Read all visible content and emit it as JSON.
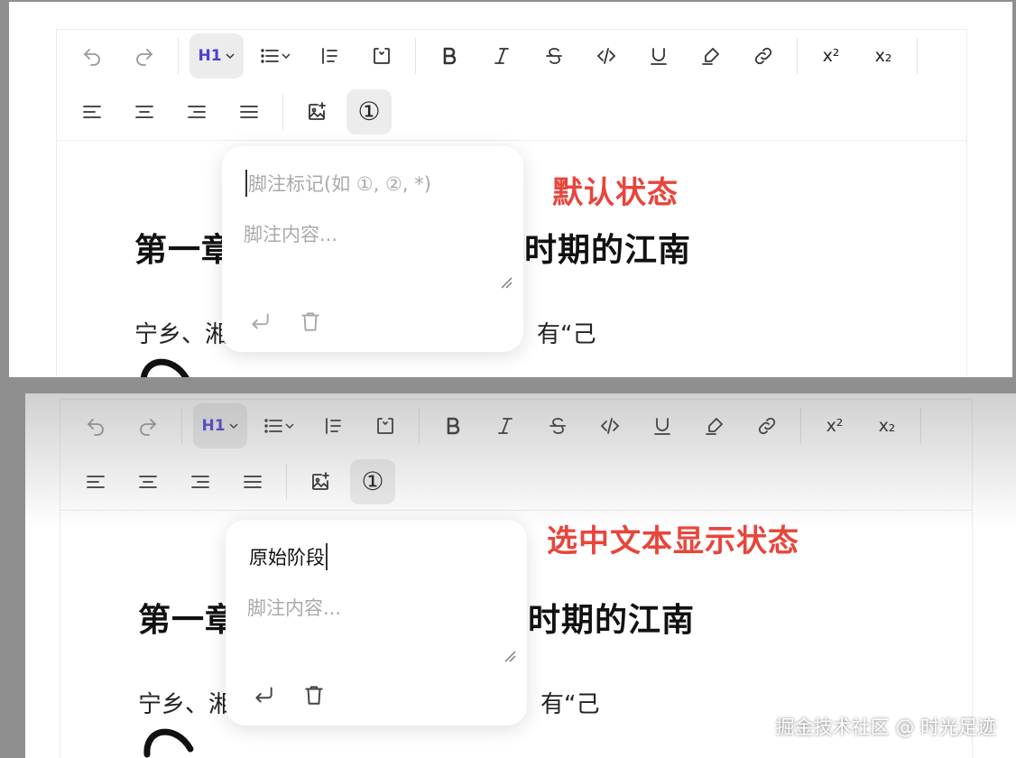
{
  "toolbar": {
    "heading_label": "H1",
    "footnote_glyph": "①",
    "superscript_label": "x²",
    "subscript_label": "x₂",
    "accent_color": "#4a3fd6"
  },
  "document": {
    "heading_left": "第一章",
    "heading_right": "时期的江南",
    "paragraph_left": "宁乡、湘",
    "paragraph_right": "有“己"
  },
  "panel_default": {
    "callout": "默认状态",
    "footnote_mark_placeholder": "脚注标记(如 ①, ②, *)",
    "footnote_content_placeholder": "脚注内容...",
    "footnote_mark_value": ""
  },
  "panel_selected": {
    "callout": "选中文本显示状态",
    "footnote_mark_value": "原始阶段",
    "footnote_content_placeholder": "脚注内容..."
  },
  "watermark": "掘金技术社区 @ 时光足迹",
  "colors": {
    "callout": "#e8453c",
    "accent": "#4a3fd6"
  }
}
